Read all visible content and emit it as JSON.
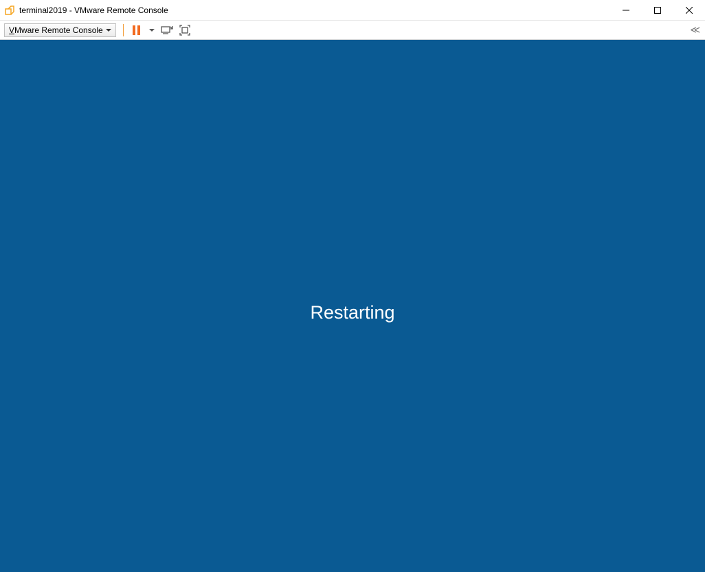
{
  "window": {
    "title": "terminal2019 - VMware Remote Console"
  },
  "toolbar": {
    "menu_label_prefix": "V",
    "menu_label_rest": "Mware Remote Console"
  },
  "guest": {
    "status_text": "Restarting"
  },
  "colors": {
    "guest_bg": "#0a5a93",
    "accent_orange": "#f26b21"
  }
}
